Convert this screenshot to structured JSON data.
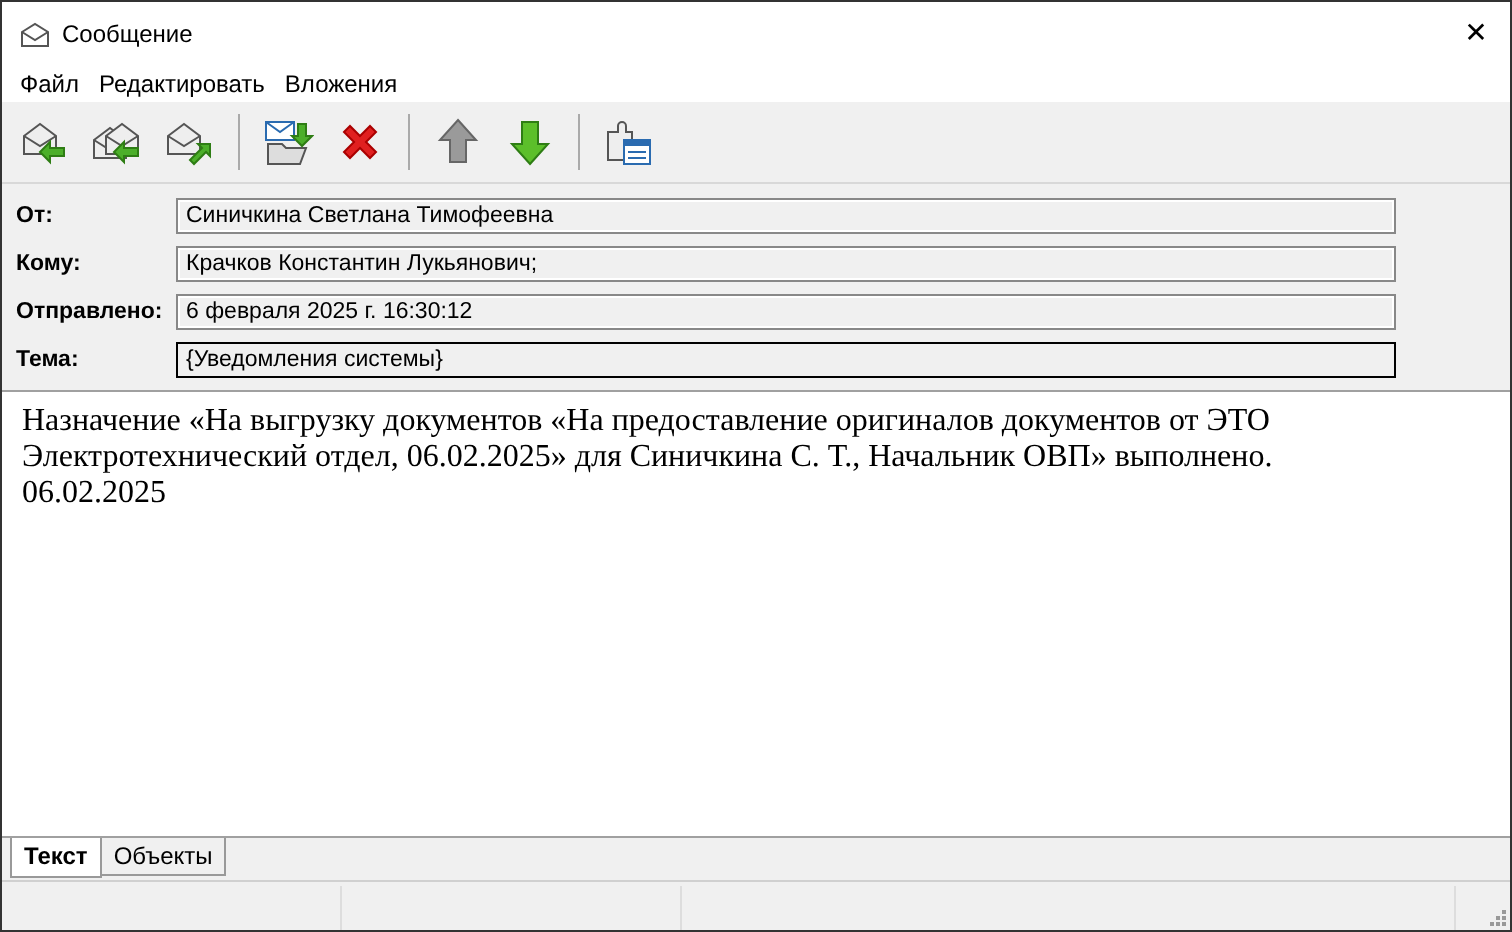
{
  "window": {
    "title": "Сообщение",
    "close": "✕"
  },
  "menu": [
    "Файл",
    "Редактировать",
    "Вложения"
  ],
  "fields": [
    {
      "label": "От:",
      "value": "Синичкина Светлана Тимофеевна",
      "focused": false
    },
    {
      "label": "Кому:",
      "value": "Крачков Константин Лукьянович;",
      "focused": false
    },
    {
      "label": "Отправлено:",
      "value": "6 февраля 2025 г. 16:30:12",
      "focused": false
    },
    {
      "label": "Тема:",
      "value": "{Уведомления системы}",
      "focused": true
    }
  ],
  "body": [
    "Назначение «На выгрузку документов «На предоставление оригиналов документов от ЭТО Электротехнический отдел, 06.02.2025» для Синичкина С. Т., Начальник ОВП» выполнено.",
    "06.02.2025"
  ],
  "tabs": [
    {
      "label": "Текст",
      "selected": true
    },
    {
      "label": "Объекты",
      "selected": false
    }
  ]
}
